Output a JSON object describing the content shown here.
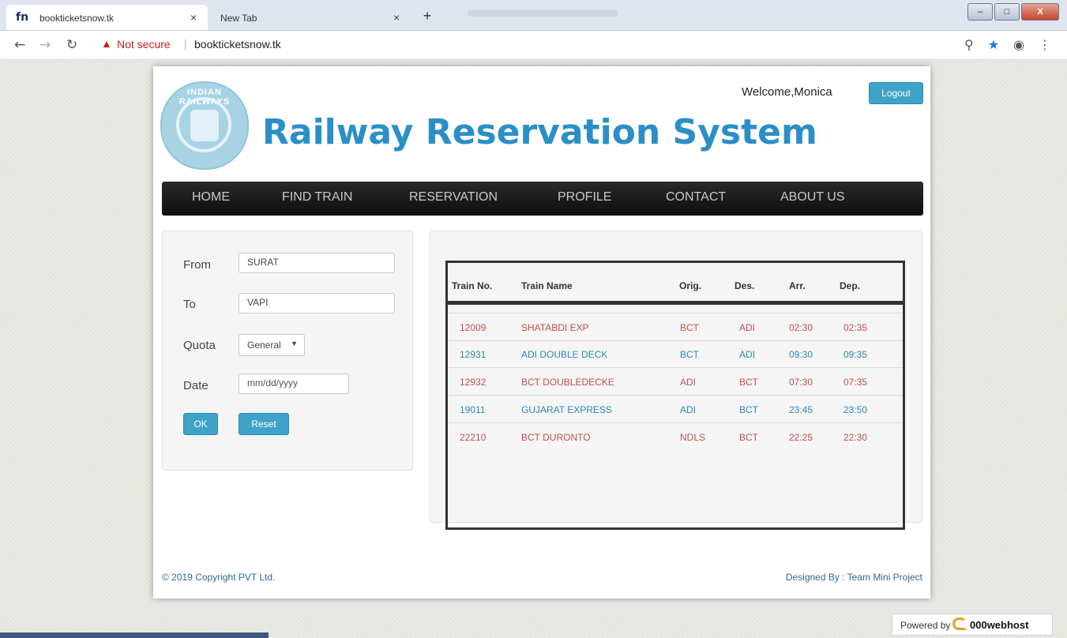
{
  "browser": {
    "tabs": [
      {
        "title": "bookticketsnow.tk",
        "favicon": "fn",
        "active": true
      },
      {
        "title": "New Tab",
        "active": false
      }
    ],
    "new_tab": "+",
    "close_glyph": "×",
    "security": "Not secure",
    "url": "bookticketsnow.tk",
    "window_controls": {
      "minimize": "–",
      "maximize": "□",
      "close": "X"
    }
  },
  "header": {
    "logo_text": "INDIAN RAILWAYS",
    "title": "Railway Reservation System",
    "welcome": "Welcome,Monica",
    "logout": "Logout"
  },
  "nav": {
    "items": [
      "HOME",
      "FIND TRAIN",
      "RESERVATION",
      "PROFILE",
      "CONTACT",
      "ABOUT US"
    ]
  },
  "form": {
    "from_label": "From",
    "from_value": "SURAT",
    "to_label": "To",
    "to_value": "VAPI",
    "quota_label": "Quota",
    "quota_value": "General",
    "date_label": "Date",
    "date_placeholder": "mm/dd/yyyy",
    "ok": "OK",
    "reset": "Reset"
  },
  "results": {
    "headers": [
      "Train No.",
      "Train Name",
      "Orig.",
      "Des.",
      "Arr.",
      "Dep."
    ],
    "rows": [
      [
        "12009",
        "SHATABDI EXP",
        "BCT",
        "ADI",
        "02:30",
        "02:35"
      ],
      [
        "12931",
        "ADI DOUBLE DECK",
        "BCT",
        "ADI",
        "09:30",
        "09:35"
      ],
      [
        "12932",
        "BCT DOUBLEDECKE",
        "ADI",
        "BCT",
        "07:30",
        "07:35"
      ],
      [
        "19011",
        "GUJARAT EXPRESS",
        "ADI",
        "BCT",
        "23:45",
        "23:50"
      ],
      [
        "22210",
        "BCT DURONTO",
        "NDLS",
        "BCT",
        "22:25",
        "22:30"
      ]
    ]
  },
  "footer": {
    "copyright": "© 2019 Copyright PVT Ltd.",
    "designed_by": "Designed By : Team Mini Project"
  },
  "powered": {
    "prefix": "Powered by",
    "brand": "000webhost"
  },
  "colors": {
    "title_blue": "#2b8fc7",
    "button_blue": "#3fa3c9",
    "row_red": "#c0504d",
    "row_blue": "#2f86b5",
    "nav_bg": "#111111"
  }
}
